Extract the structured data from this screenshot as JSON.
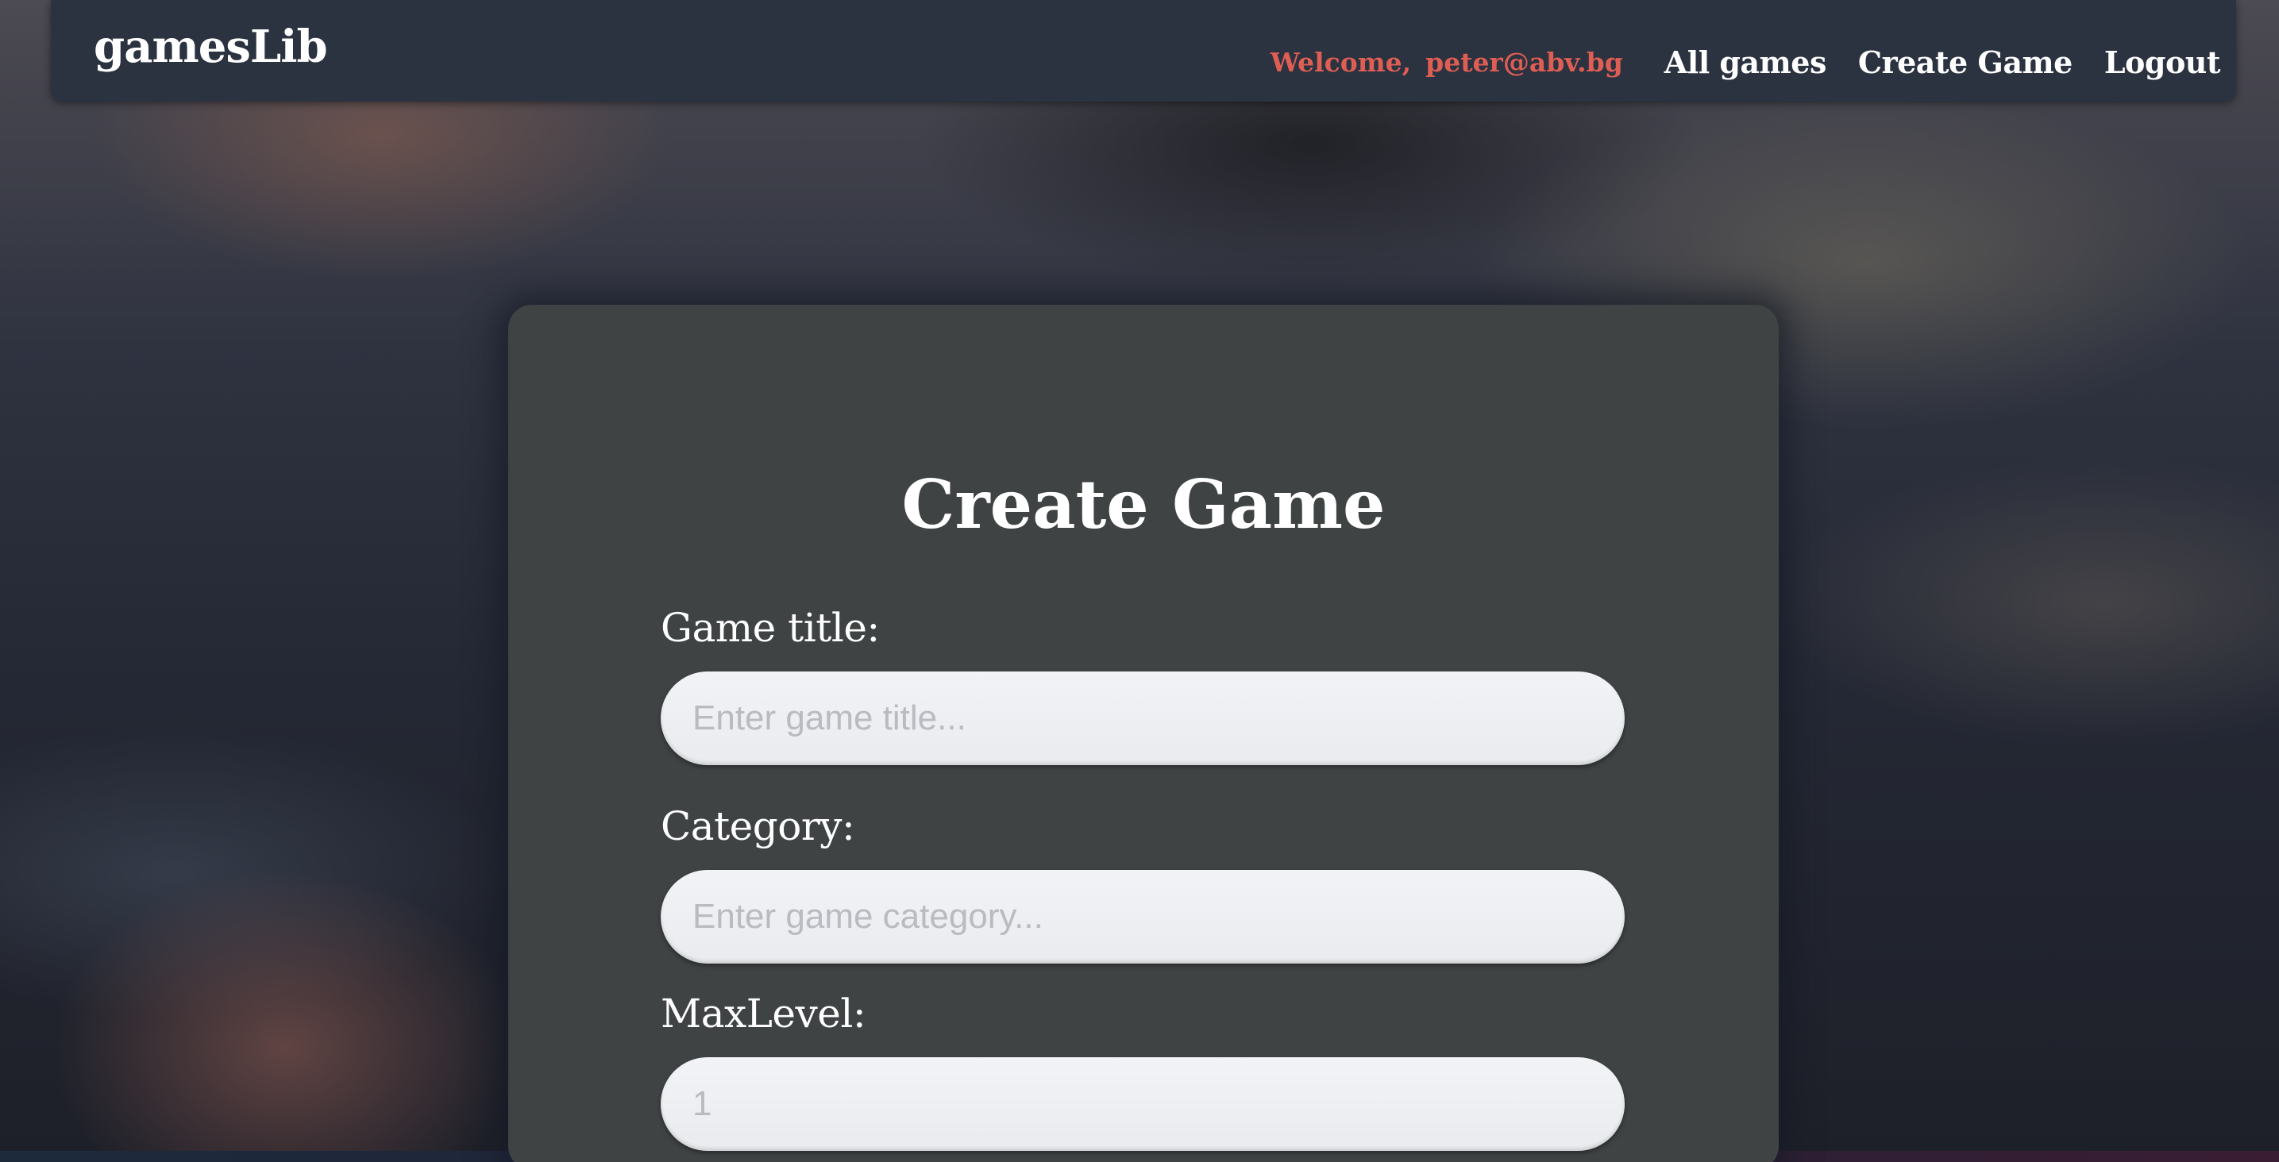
{
  "header": {
    "brand": "gamesLib",
    "welcome_prefix": "Welcome,",
    "user_email": "peter@abv.bg",
    "nav": {
      "all_games": "All games",
      "create_game": "Create Game",
      "logout": "Logout"
    }
  },
  "form": {
    "title": "Create Game",
    "fields": {
      "title": {
        "label": "Game title:",
        "placeholder": "Enter game title..."
      },
      "category": {
        "label": "Category:",
        "placeholder": "Enter game category..."
      },
      "max_level": {
        "label": "MaxLevel:",
        "placeholder": "1"
      }
    }
  },
  "colors": {
    "navbar_bg": "#2b3240",
    "welcome_text": "#df5e54",
    "card_bg": "#3f4343",
    "input_bg": "#eceef1"
  }
}
